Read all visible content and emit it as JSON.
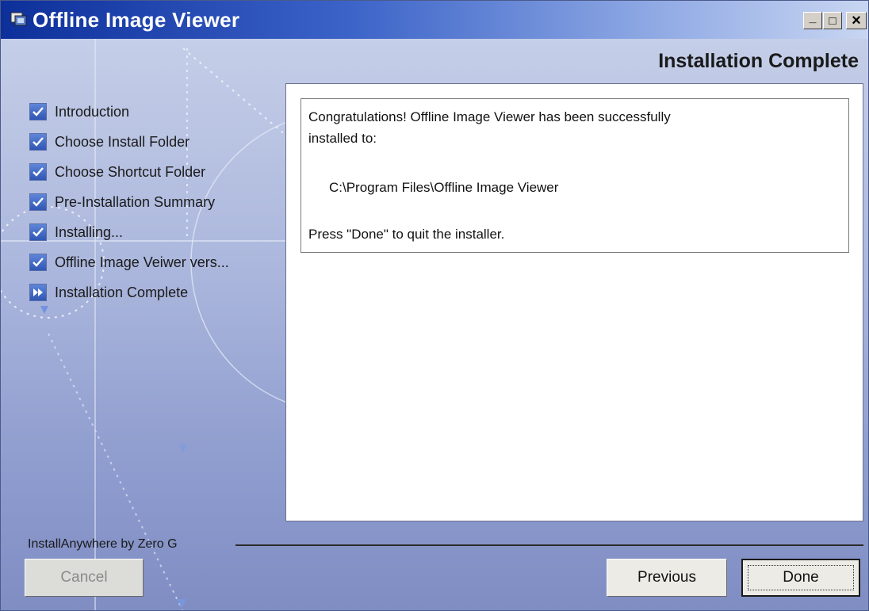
{
  "window": {
    "title": "Offline Image Viewer",
    "controls": {
      "minimize": "_",
      "maximize": "□",
      "close": "×"
    }
  },
  "header": {
    "title": "Installation Complete"
  },
  "steps": [
    {
      "label": "Introduction",
      "status": "done",
      "icon": "checkmark-icon"
    },
    {
      "label": "Choose Install Folder",
      "status": "done",
      "icon": "checkmark-icon"
    },
    {
      "label": "Choose Shortcut Folder",
      "status": "done",
      "icon": "checkmark-icon"
    },
    {
      "label": "Pre-Installation Summary",
      "status": "done",
      "icon": "checkmark-icon"
    },
    {
      "label": "Installing...",
      "status": "done",
      "icon": "checkmark-icon"
    },
    {
      "label": "Offline Image Veiwer vers...",
      "status": "done",
      "icon": "checkmark-icon"
    },
    {
      "label": "Installation Complete",
      "status": "current",
      "icon": "fast-forward-icon"
    }
  ],
  "message": {
    "line1": "Congratulations! Offline Image Viewer has been successfully",
    "line2": "installed to:",
    "path": "C:\\Program Files\\Offline Image Viewer",
    "instruction": "Press \"Done\" to quit the installer."
  },
  "footer": {
    "brand": "InstallAnywhere by Zero G"
  },
  "buttons": {
    "cancel": "Cancel",
    "previous": "Previous",
    "done": "Done"
  },
  "colors": {
    "title_bar_start": "#0d2f9a",
    "background": "#aab6dc",
    "step_icon": "#2f56b4"
  }
}
